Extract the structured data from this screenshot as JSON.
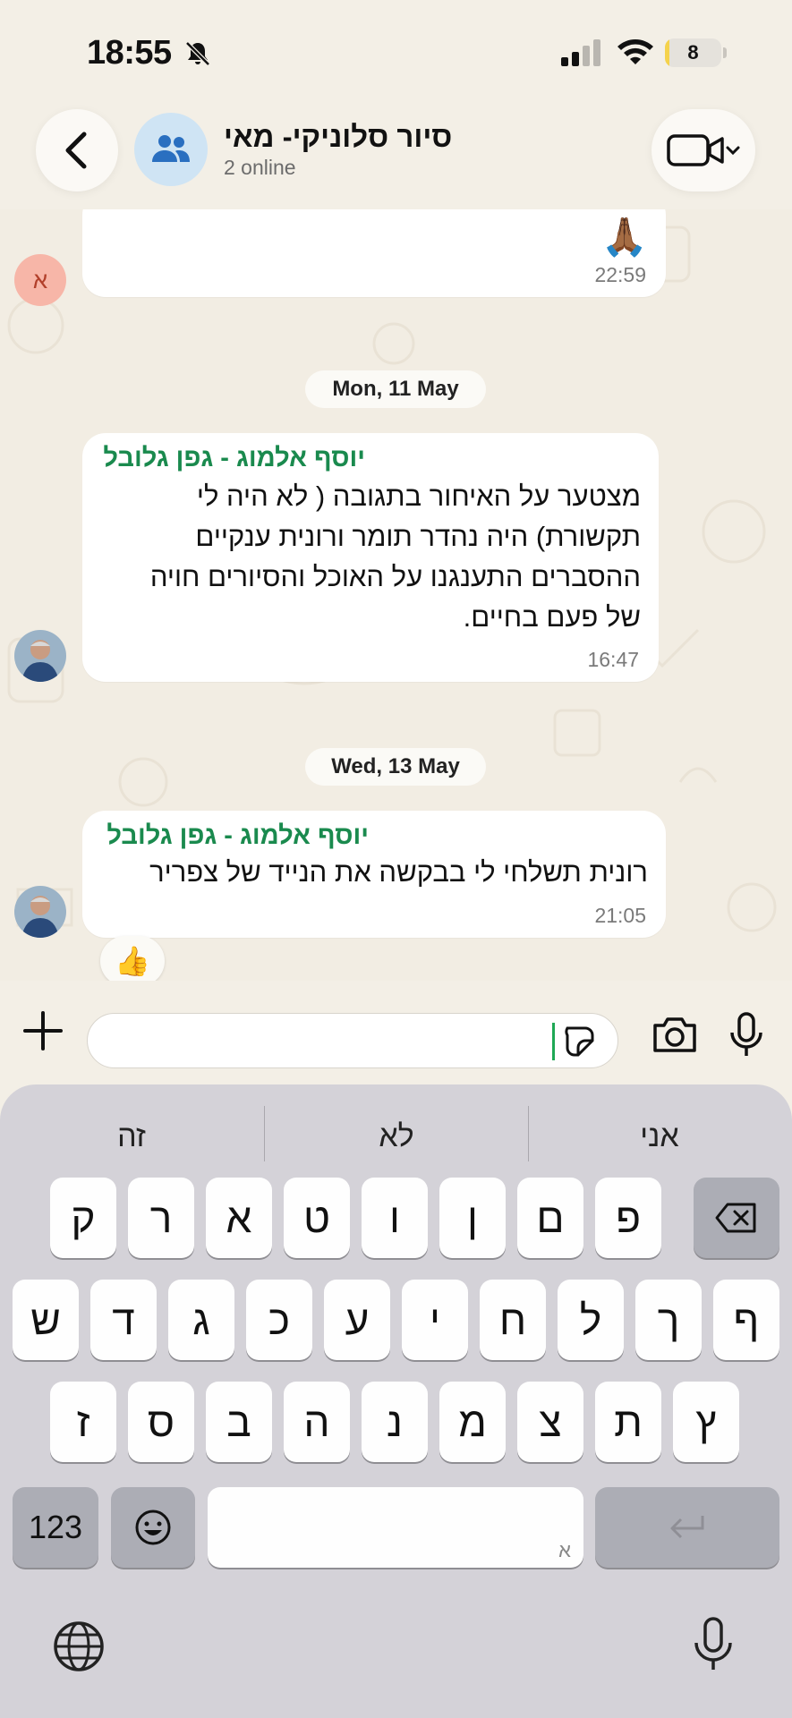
{
  "status_bar": {
    "time": "18:55",
    "battery": "8",
    "battery_level": 0.08
  },
  "header": {
    "title": "סיור סלוניקי- מאי",
    "subtitle": "2 online",
    "back_icon": "chevron-left-icon",
    "video_icon": "video-camera-icon"
  },
  "messages": [
    {
      "avatar_letter": "א",
      "text": "🙏🏾",
      "time": "22:59"
    },
    {
      "date": "Mon, 11 May"
    },
    {
      "sender": "יוסף אלמוג - גפן גלובל",
      "lines": [
        "מצטער על האיחור בתגובה  ( לא היה לי",
        "תקשורת) היה נהדר תומר ורונית ענקיים",
        "ההסברים התענגנו על האוכל והסיורים חויה",
        "של פעם בחיים."
      ],
      "time": "16:47"
    },
    {
      "date": "Wed, 13 May"
    },
    {
      "sender": "יוסף אלמוג - גפן גלובל",
      "text": "רונית תשלחי לי בבקשה את הנייד של צפריר",
      "time": "21:05",
      "reaction": "👍"
    }
  ],
  "input": {
    "placeholder": ""
  },
  "keyboard": {
    "suggestions": [
      "אני",
      "לא",
      "זה"
    ],
    "row1": [
      "ק",
      "ר",
      "א",
      "ט",
      "ו",
      "ן",
      "ם",
      "פ"
    ],
    "row2": [
      "ש",
      "ד",
      "ג",
      "כ",
      "ע",
      "י",
      "ח",
      "ל",
      "ך",
      "ף"
    ],
    "row3": [
      "ז",
      "ס",
      "ב",
      "ה",
      "נ",
      "מ",
      "צ",
      "ת",
      "ץ"
    ],
    "numbers_label": "123",
    "space_hint": "א"
  },
  "colors": {
    "sender": "#1a8a4e",
    "accent": "#1fa855",
    "bubble": "#ffffff",
    "chat_bg": "#f2ede3"
  }
}
